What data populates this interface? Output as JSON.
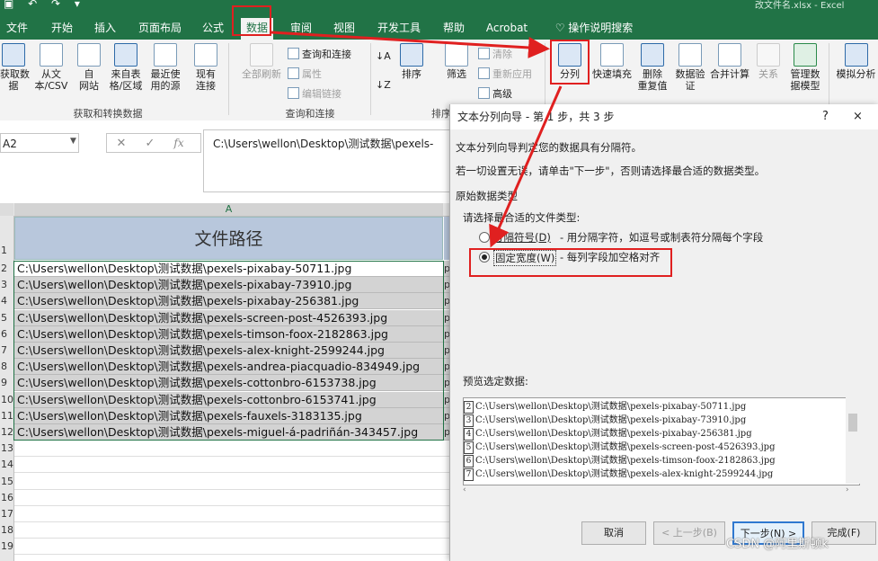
{
  "window": {
    "filename": "改文件名.xlsx  -  Excel"
  },
  "tabs": [
    {
      "label": "文件"
    },
    {
      "label": "开始"
    },
    {
      "label": "插入"
    },
    {
      "label": "页面布局"
    },
    {
      "label": "公式"
    },
    {
      "label": "数据"
    },
    {
      "label": "审阅"
    },
    {
      "label": "视图"
    },
    {
      "label": "开发工具"
    },
    {
      "label": "帮助"
    },
    {
      "label": "Acrobat"
    },
    {
      "label": "操作说明搜索"
    }
  ],
  "ribbon": {
    "get_data": "获取数\n据",
    "from_text": "从文\n本/CSV",
    "from_web": "自\n网站",
    "from_table": "来自表\n格/区域",
    "recent_sources": "最近使\n用的源",
    "existing_conn": "现有\n连接",
    "refresh_all": "全部刷新",
    "queries_conn": "查询和连接",
    "properties": "属性",
    "edit_links": "编辑链接",
    "sort_za": "排序",
    "filter": "筛选",
    "clear": "清除",
    "reapply": "重新应用",
    "advanced": "高级",
    "text_to_columns": "分列",
    "flash_fill": "快速填充",
    "remove_dup": "删除\n重复值",
    "data_validation": "数据验\n证",
    "consolidate": "合并计算",
    "relations": "关系",
    "manage_model": "管理数\n据模型",
    "whatif": "模拟分析",
    "group_get": "获取和转换数据",
    "group_query": "查询和连接",
    "group_sort": "排序"
  },
  "formula_bar": {
    "name_box": "A2",
    "fx": "fx",
    "value": "C:\\Users\\wellon\\Desktop\\测试数据\\pexels-"
  },
  "sheet": {
    "column_a": "A",
    "header": "文件路径",
    "rows": [
      "C:\\Users\\wellon\\Desktop\\测试数据\\pexels-pixabay-50711.jpg",
      "C:\\Users\\wellon\\Desktop\\测试数据\\pexels-pixabay-73910.jpg",
      "C:\\Users\\wellon\\Desktop\\测试数据\\pexels-pixabay-256381.jpg",
      "C:\\Users\\wellon\\Desktop\\测试数据\\pexels-screen-post-4526393.jpg",
      "C:\\Users\\wellon\\Desktop\\测试数据\\pexels-timson-foox-2182863.jpg",
      "C:\\Users\\wellon\\Desktop\\测试数据\\pexels-alex-knight-2599244.jpg",
      "C:\\Users\\wellon\\Desktop\\测试数据\\pexels-andrea-piacquadio-834949.jpg",
      "C:\\Users\\wellon\\Desktop\\测试数据\\pexels-cottonbro-6153738.jpg",
      "C:\\Users\\wellon\\Desktop\\测试数据\\pexels-cottonbro-6153741.jpg",
      "C:\\Users\\wellon\\Desktop\\测试数据\\pexels-fauxels-3183135.jpg",
      "C:\\Users\\wellon\\Desktop\\测试数据\\pexels-miguel-á-padriñán-343457.jpg"
    ],
    "col_b_char": "p",
    "row_numbers": [
      "1",
      "2",
      "3",
      "4",
      "5",
      "6",
      "7",
      "8",
      "9",
      "10",
      "11",
      "12",
      "13",
      "14",
      "15",
      "16",
      "17",
      "18",
      "19"
    ]
  },
  "dialog": {
    "title": "文本分列向导 - 第 1 步，共 3 步",
    "help": "?",
    "close": "×",
    "desc1": "文本分列向导判定您的数据具有分隔符。",
    "desc2": "若一切设置无误，请单击\"下一步\"，否则请选择最合适的数据类型。",
    "section": "原始数据类型",
    "choose": "请选择最合适的文件类型:",
    "opt_delimited": "分隔符号(D)",
    "opt_delimited_desc": "- 用分隔字符，如逗号或制表符分隔每个字段",
    "opt_fixed": "固定宽度(W)",
    "opt_fixed_desc": "- 每列字段加空格对齐",
    "preview_label": "预览选定数据:",
    "preview": [
      {
        "n": "2",
        "text": "C:\\Users\\wellon\\Desktop\\测试数据\\pexels-pixabay-50711.jpg"
      },
      {
        "n": "3",
        "text": "C:\\Users\\wellon\\Desktop\\测试数据\\pexels-pixabay-73910.jpg"
      },
      {
        "n": "4",
        "text": "C:\\Users\\wellon\\Desktop\\测试数据\\pexels-pixabay-256381.jpg"
      },
      {
        "n": "5",
        "text": "C:\\Users\\wellon\\Desktop\\测试数据\\pexels-screen-post-4526393.jpg"
      },
      {
        "n": "6",
        "text": "C:\\Users\\wellon\\Desktop\\测试数据\\pexels-timson-foox-2182863.jpg"
      },
      {
        "n": "7",
        "text": "C:\\Users\\wellon\\Desktop\\测试数据\\pexels-alex-knight-2599244.jpg"
      }
    ],
    "btn_cancel": "取消",
    "btn_back": "< 上一步(B)",
    "btn_next": "下一步(N) >",
    "btn_finish": "完成(F)"
  },
  "watermark": "CSDN @阿里斯顿k",
  "colors": {
    "excel_green": "#217346",
    "annotation_red": "#e02020"
  }
}
